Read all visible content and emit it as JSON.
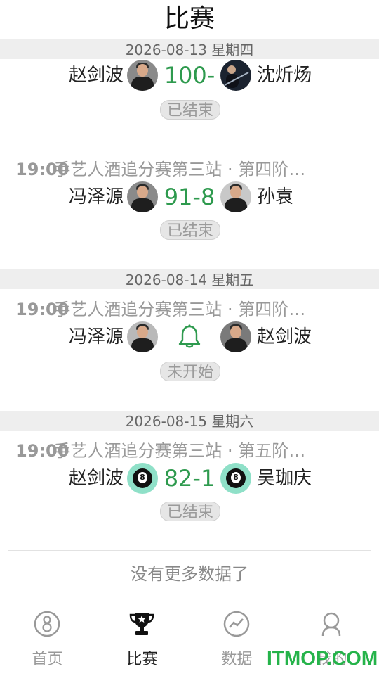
{
  "header": {
    "title": "比赛"
  },
  "groups": [
    {
      "date": "2026-08-13 星期四"
    },
    {
      "date": "2026-08-14 星期五"
    },
    {
      "date": "2026-08-15 星期六"
    }
  ],
  "matches": [
    {
      "time": "",
      "event": "",
      "left_player": "赵剑波",
      "right_player": "沈炘炀",
      "score": "100-",
      "status": "已结束"
    },
    {
      "time": "19:00",
      "event": "手艺人酒追分赛第三站 · 第四阶…",
      "left_player": "冯泽源",
      "right_player": "孙袁",
      "score": "91-8",
      "status": "已结束"
    },
    {
      "time": "19:00",
      "event": "手艺人酒追分赛第三站 · 第四阶…",
      "left_player": "冯泽源",
      "right_player": "赵剑波",
      "score": "",
      "status": "未开始"
    },
    {
      "time": "19:00",
      "event": "手艺人酒追分赛第三站 · 第五阶…",
      "left_player": "赵剑波",
      "right_player": "吴珈庆",
      "score": "82-1",
      "status": "已结束"
    }
  ],
  "footer_text": "没有更多数据了",
  "tabs": [
    {
      "label": "首页",
      "icon": "billiard-8-icon"
    },
    {
      "label": "比赛",
      "icon": "trophy-icon"
    },
    {
      "label": "数据",
      "icon": "chart-icon"
    },
    {
      "label": "我的",
      "icon": "user-icon"
    }
  ],
  "watermark": "ITMOP.COM",
  "colors": {
    "score": "#2e9a4e",
    "bell": "#2e9a4e",
    "date_bar": "#eeeeee",
    "muted": "#999999"
  }
}
